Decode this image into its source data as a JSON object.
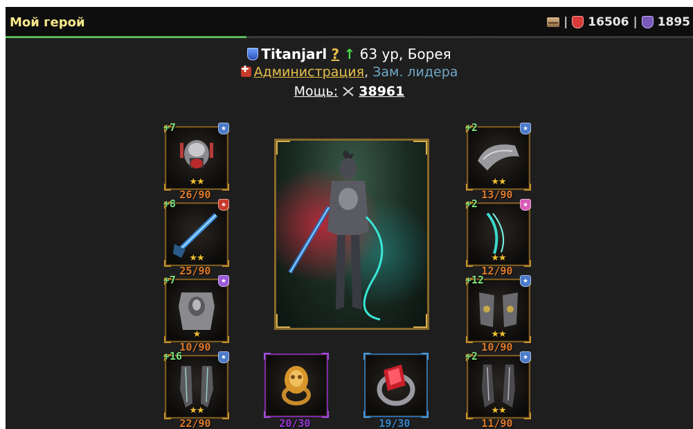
{
  "topbar": {
    "title": "Мой герой",
    "progress_percent": 35,
    "separator": "|",
    "red_value": "16506",
    "purple_value": "1895"
  },
  "hero": {
    "name": "Titanjarl",
    "help": "?",
    "level_text": "63 ур, Борея",
    "clan": "Администрация",
    "clan_sep": ",",
    "role": "Зам. лидера",
    "power_label": "Мощь:",
    "power_value": "38961"
  },
  "slots": {
    "helmet": {
      "enh": "+7",
      "stars": "★★",
      "dur": "26/90"
    },
    "weapon": {
      "enh": "+8",
      "stars": "★★",
      "dur": "25/90"
    },
    "armor": {
      "enh": "+7",
      "stars": "★",
      "dur": "10/90"
    },
    "gloves": {
      "enh": "+16",
      "stars": "★★",
      "dur": "22/90"
    },
    "shoulders": {
      "enh": "+2",
      "stars": "★★",
      "dur": "13/90"
    },
    "offhand": {
      "enh": "+2",
      "stars": "★★",
      "dur": "12/90"
    },
    "bracers": {
      "enh": "+12",
      "stars": "★★",
      "dur": "10/90"
    },
    "boots": {
      "enh": "+2",
      "stars": "★★",
      "dur": "11/90"
    },
    "ring_gold": {
      "dur": "20/30"
    },
    "ring_red": {
      "dur": "19/30"
    }
  },
  "colors": {
    "title": "#f5e88a",
    "progress": "#5cb85c",
    "durability": "#e07a2a",
    "ring_gold_dur": "#9a3ad8",
    "ring_red_dur": "#3a8ad0",
    "enhance": "#7ee07e"
  },
  "icons": {
    "mail": "mail-icon",
    "red": "red-shield-icon",
    "purple": "purple-shield-icon",
    "race": "race-icon",
    "clan": "clan-emblem-icon",
    "power": "crossed-swords-icon"
  }
}
